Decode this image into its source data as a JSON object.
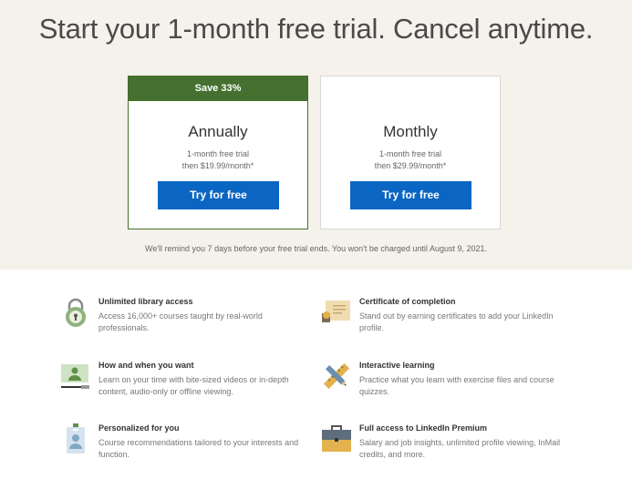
{
  "hero": {
    "title": "Start your 1-month free trial. Cancel anytime."
  },
  "plans": [
    {
      "badge": "Save 33%",
      "name": "Annually",
      "note_line1": "1-month free trial",
      "note_line2": "then $19.99/month*",
      "button": "Try for free"
    },
    {
      "name": "Monthly",
      "note_line1": "1-month free trial",
      "note_line2": "then $29.99/month*",
      "button": "Try for free"
    }
  ],
  "reminder": "We'll remind you 7 days before your free trial ends. You won't be charged until August 9, 2021.",
  "features": [
    {
      "icon": "lock-icon",
      "title": "Unlimited library access",
      "desc": "Access 16,000+ courses taught by real-world professionals."
    },
    {
      "icon": "certificate-icon",
      "title": "Certificate of completion",
      "desc": "Stand out by earning certificates to add your LinkedIn profile."
    },
    {
      "icon": "video-lesson-icon",
      "title": "How and when you want",
      "desc": "Learn on your time with bite-sized videos or in-depth content, audio-only or offline viewing."
    },
    {
      "icon": "pencil-ruler-icon",
      "title": "Interactive learning",
      "desc": "Practice what you learn with exercise files and course quizzes."
    },
    {
      "icon": "id-badge-icon",
      "title": "Personalized for you",
      "desc": "Course recommendations tailored to your interests and function."
    },
    {
      "icon": "briefcase-icon",
      "title": "Full access to LinkedIn Premium",
      "desc": "Salary and job insights, unlimited profile viewing, InMail credits, and more."
    }
  ],
  "colors": {
    "hero_bg": "#f5f1eb",
    "accent_green": "#46702f",
    "button_blue": "#0a66c2"
  }
}
